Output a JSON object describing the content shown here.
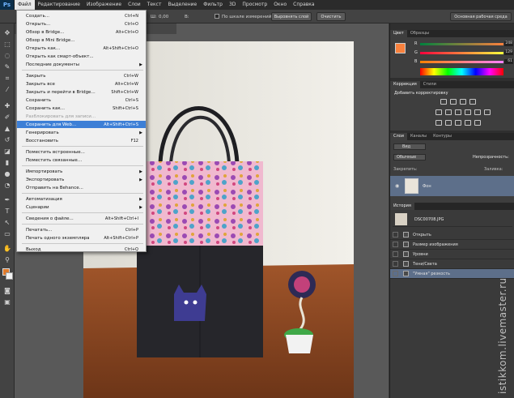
{
  "app": {
    "logo": "Ps"
  },
  "menubar": {
    "items": [
      "Файл",
      "Редактирование",
      "Изображение",
      "Слои",
      "Текст",
      "Выделение",
      "Фильтр",
      "3D",
      "Просмотр",
      "Окно",
      "Справка"
    ]
  },
  "optionsbar": {
    "w_label": "Ш:",
    "w_value": "0,00",
    "h_label": "В:",
    "check_label": "По шкале измерений",
    "align_button": "Выровнять слой",
    "clear_button": "Очистить",
    "workspace": "Основная рабочая среда"
  },
  "file_menu": {
    "items": [
      {
        "label": "Создать...",
        "shortcut": "Ctrl+N"
      },
      {
        "label": "Открыть...",
        "shortcut": "Ctrl+O"
      },
      {
        "label": "Обзор в Bridge...",
        "shortcut": "Alt+Ctrl+O"
      },
      {
        "label": "Обзор в Mini Bridge...",
        "shortcut": ""
      },
      {
        "label": "Открыть как...",
        "shortcut": "Alt+Shift+Ctrl+O"
      },
      {
        "label": "Открыть как смарт-объект...",
        "shortcut": ""
      },
      {
        "label": "Последние документы",
        "shortcut": "",
        "submenu": true
      },
      {
        "label": "Закрыть",
        "shortcut": "Ctrl+W"
      },
      {
        "label": "Закрыть все",
        "shortcut": "Alt+Ctrl+W"
      },
      {
        "label": "Закрыть и перейти в Bridge...",
        "shortcut": "Shift+Ctrl+W"
      },
      {
        "label": "Сохранить",
        "shortcut": "Ctrl+S"
      },
      {
        "label": "Сохранить как...",
        "shortcut": "Shift+Ctrl+S"
      },
      {
        "label": "Разблокировать для записи...",
        "shortcut": "",
        "disabled": true
      },
      {
        "label": "Сохранить для Web...",
        "shortcut": "Alt+Shift+Ctrl+S",
        "highlighted": true
      },
      {
        "label": "Генерировать",
        "shortcut": "",
        "submenu": true
      },
      {
        "label": "Восстановить",
        "shortcut": "F12"
      },
      {
        "label": "Поместить встроенные...",
        "shortcut": ""
      },
      {
        "label": "Поместить связанные...",
        "shortcut": ""
      },
      {
        "label": "Импортировать",
        "shortcut": "",
        "submenu": true
      },
      {
        "label": "Экспортировать",
        "shortcut": "",
        "submenu": true
      },
      {
        "label": "Отправить на Behance...",
        "shortcut": ""
      },
      {
        "label": "Автоматизация",
        "shortcut": "",
        "submenu": true
      },
      {
        "label": "Сценарии",
        "shortcut": "",
        "submenu": true
      },
      {
        "label": "Сведения о файле...",
        "shortcut": "Alt+Shift+Ctrl+I"
      },
      {
        "label": "Печатать...",
        "shortcut": "Ctrl+P"
      },
      {
        "label": "Печать одного экземпляра",
        "shortcut": "Alt+Shift+Ctrl+P"
      },
      {
        "label": "Выход",
        "shortcut": "Ctrl+Q"
      }
    ]
  },
  "color_panel": {
    "tabs": [
      "Цвет",
      "Образцы"
    ],
    "r_label": "R",
    "g_label": "G",
    "b_label": "B",
    "r_value": "248",
    "g_value": "129",
    "b_value": "61",
    "r": 248,
    "g": 129,
    "b": 61,
    "fg_color": "#f8813d"
  },
  "adjust_panel": {
    "tabs": [
      "Коррекция",
      "Стили"
    ],
    "title": "Добавить корректировку"
  },
  "layers_panel": {
    "tabs": [
      "Слои",
      "Каналы",
      "Контуры"
    ],
    "kind_label": "Вид",
    "blend_mode": "Обычные",
    "opacity_label": "Непрозрачность:",
    "lock_label": "Закрепить:",
    "fill_label": "Заливка:",
    "layer_name": "Фон"
  },
  "history_panel": {
    "tab": "История",
    "snapshot": "DSC00708.JPG",
    "steps": [
      "Открыть",
      "Размер изображения",
      "Уровни",
      "Тени/Света",
      "\"Умная\" резкость"
    ]
  },
  "watermark": "istikkom.livemaster.ru"
}
